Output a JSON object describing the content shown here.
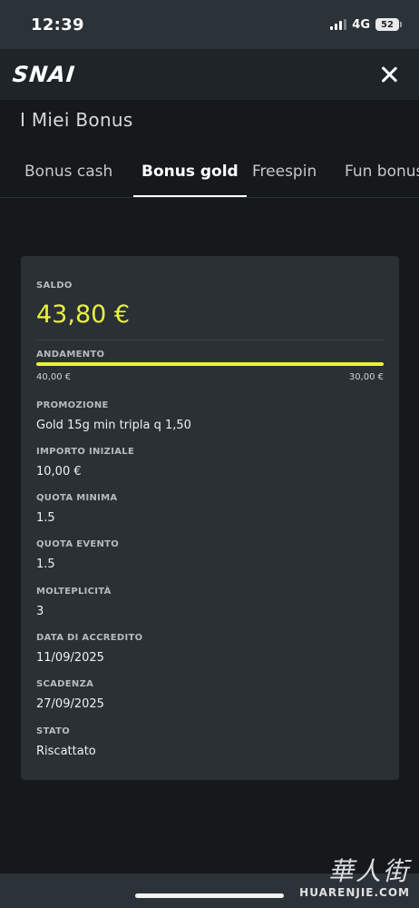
{
  "status_bar": {
    "time": "12:39",
    "network": "4G",
    "battery": "52"
  },
  "app": {
    "logo": "SNAI"
  },
  "page": {
    "title": "I Miei Bonus"
  },
  "tabs": [
    {
      "label": "Bonus cash",
      "active": false
    },
    {
      "label": "Bonus gold",
      "active": true
    },
    {
      "label": "Freespin",
      "active": false
    },
    {
      "label": "Fun bonus",
      "active": false
    }
  ],
  "bonus": {
    "saldo_label": "SALDO",
    "saldo_value": "43,80 €",
    "andamento_label": "ANDAMENTO",
    "andamento_progress": 1.0,
    "andamento_start": "40,00 €",
    "andamento_end": "30,00 €",
    "details": [
      {
        "label": "PROMOZIONE",
        "value": "Gold 15g min tripla q 1,50"
      },
      {
        "label": "IMPORTO INIZIALE",
        "value": "10,00 €"
      },
      {
        "label": "QUOTA MINIMA",
        "value": "1.5"
      },
      {
        "label": "QUOTA EVENTO",
        "value": "1.5"
      },
      {
        "label": "MOLTEPLICITÀ",
        "value": "3"
      },
      {
        "label": "DATA DI ACCREDITO",
        "value": "11/09/2025"
      },
      {
        "label": "SCADENZA",
        "value": "27/09/2025"
      },
      {
        "label": "STATO",
        "value": "Riscattato"
      }
    ]
  },
  "watermark": {
    "chinese": "華人街",
    "latin": "HUARENJIE.COM"
  },
  "colors": {
    "accent": "#e8f23a",
    "background": "#15191c",
    "card": "#2a3034"
  }
}
